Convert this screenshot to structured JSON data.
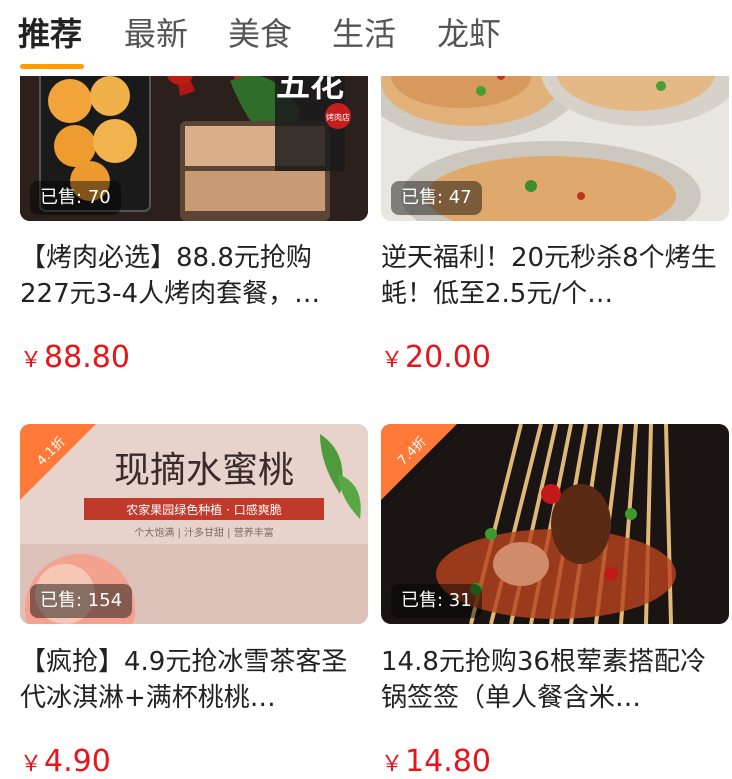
{
  "tabs": [
    {
      "label": "推荐",
      "active": true
    },
    {
      "label": "最新",
      "active": false
    },
    {
      "label": "美食",
      "active": false
    },
    {
      "label": "生活",
      "active": false
    },
    {
      "label": "龙虾",
      "active": false
    }
  ],
  "accent_color": "#ff9c00",
  "price_color": "#e8141a",
  "cards": [
    {
      "sold": "已售: 70",
      "title": "【烤肉必选】88.8元抢购227元3-4人烤肉套餐，…",
      "currency": "￥",
      "price": "88.80",
      "image_brand_text": "五花",
      "image_sub_text": "烤肉店"
    },
    {
      "sold": "已售: 47",
      "title": "逆天福利！20元秒杀8个烤生蚝！低至2.5元/个…",
      "currency": "￥",
      "price": "20.00"
    },
    {
      "sold": "已售: 154",
      "title": "【疯抢】4.9元抢冰雪茶客圣代冰淇淋+满杯桃桃…",
      "currency": "￥",
      "price": "4.90",
      "discount": "4.1折",
      "image_headline": "现摘水蜜桃",
      "image_banner": "农家果园绿色种植 · 口感爽脆",
      "image_tagline": "个大饱满 | 汁多甘甜 | 营养丰富"
    },
    {
      "sold": "已售: 31",
      "title": "14.8元抢购36根荤素搭配冷锅签签（单人餐含米…",
      "currency": "￥",
      "price": "14.80",
      "discount": "7.4折"
    }
  ]
}
